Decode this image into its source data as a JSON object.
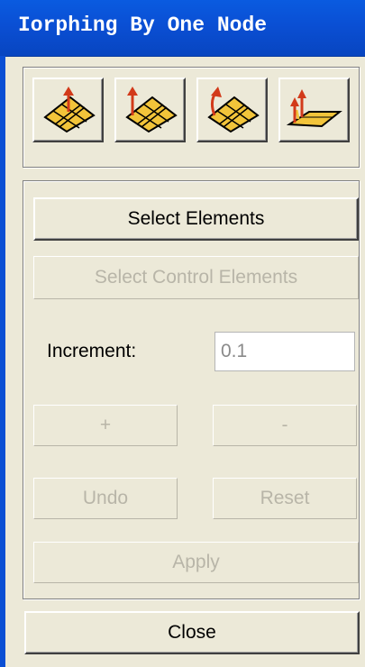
{
  "window": {
    "title": "Iorphing By One Node"
  },
  "toolbar": {
    "icons": [
      "morph-surface-icon",
      "morph-normal-icon",
      "morph-tangent-icon",
      "morph-offset-icon"
    ]
  },
  "buttons": {
    "select_elements": "Select Elements",
    "select_control_elements": "Select Control Elements",
    "plus": "+",
    "minus": "-",
    "undo": "Undo",
    "reset": "Reset",
    "apply": "Apply",
    "close": "Close"
  },
  "increment": {
    "label": "Increment:",
    "value": "0.1"
  },
  "colors": {
    "titlebar": "#0a4fd4",
    "face": "#ece9d8",
    "disabled_text": "#b8b5a8",
    "icon_face": "#f2c43a",
    "arrow": "#d23a1a"
  }
}
